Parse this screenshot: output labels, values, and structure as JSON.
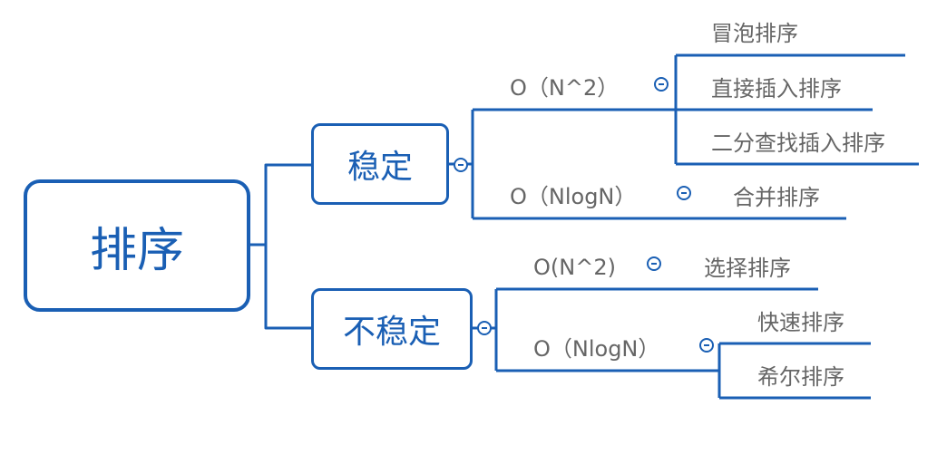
{
  "root": {
    "label": "排序"
  },
  "groups": [
    {
      "label": "稳定",
      "branches": [
        {
          "complexity": "O（N^2）",
          "algorithms": [
            "冒泡排序",
            "直接插入排序",
            "二分查找插入排序"
          ]
        },
        {
          "complexity": "O（NlogN）",
          "algorithms": [
            "合并排序"
          ]
        }
      ]
    },
    {
      "label": "不稳定",
      "branches": [
        {
          "complexity": "O(N^2)",
          "algorithms": [
            "选择排序"
          ]
        },
        {
          "complexity": "O（NlogN）",
          "algorithms": [
            "快速排序",
            "希尔排序"
          ]
        }
      ]
    }
  ],
  "colors": {
    "line": "#1a5fb4",
    "text": "#666666"
  }
}
